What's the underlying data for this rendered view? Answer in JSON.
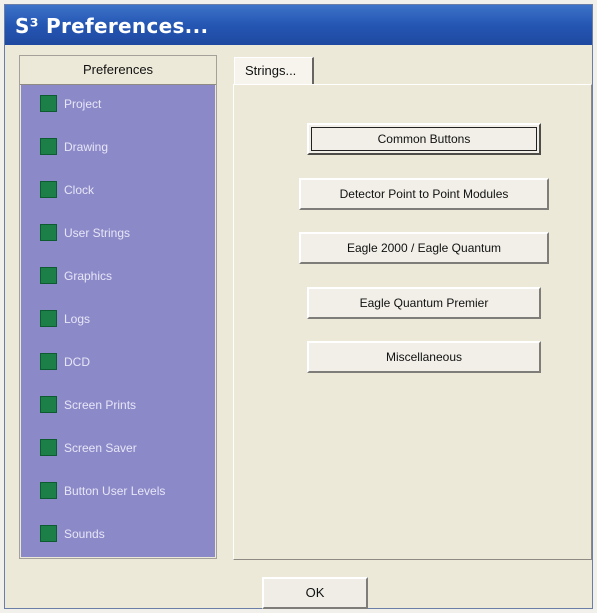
{
  "window": {
    "title": "S³ Preferences..."
  },
  "left_panel": {
    "header": "Preferences",
    "items": [
      {
        "label": "Project"
      },
      {
        "label": "Drawing"
      },
      {
        "label": "Clock"
      },
      {
        "label": "User Strings"
      },
      {
        "label": "Graphics"
      },
      {
        "label": "Logs"
      },
      {
        "label": "DCD"
      },
      {
        "label": "Screen Prints"
      },
      {
        "label": "Screen Saver"
      },
      {
        "label": "Button User Levels"
      },
      {
        "label": "Sounds"
      }
    ]
  },
  "right_panel": {
    "tab_label": "Strings...",
    "buttons": [
      {
        "label": "Common Buttons"
      },
      {
        "label": "Detector Point to Point Modules"
      },
      {
        "label": "Eagle 2000 / Eagle Quantum"
      },
      {
        "label": "Eagle Quantum Premier"
      },
      {
        "label": "Miscellaneous"
      }
    ]
  },
  "footer": {
    "ok_label": "OK"
  },
  "colors": {
    "title_bar": "#2456b3",
    "list_background": "#8c89c9",
    "item_square": "#1c7f48"
  }
}
